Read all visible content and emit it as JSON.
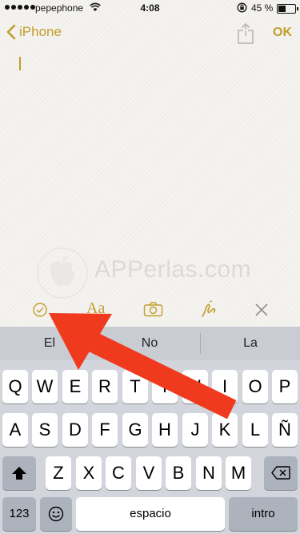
{
  "status_bar": {
    "carrier": "pepephone",
    "time": "4:08",
    "battery_percent": "45 %",
    "battery_level": 0.45
  },
  "nav": {
    "back_label": "iPhone",
    "ok_label": "OK",
    "accent_color": "#c59d2b"
  },
  "watermark": {
    "text": "APPerlas.com"
  },
  "toolbar": {
    "format_label": "Aa",
    "icons": [
      "checklist-icon",
      "format-icon",
      "camera-icon",
      "sketch-icon",
      "close-icon"
    ]
  },
  "keyboard": {
    "predictions": [
      "El",
      "No",
      "La"
    ],
    "row1": [
      "Q",
      "W",
      "E",
      "R",
      "T",
      "Y",
      "U",
      "I",
      "O",
      "P"
    ],
    "row2": [
      "A",
      "S",
      "D",
      "F",
      "G",
      "H",
      "J",
      "K",
      "L",
      "Ñ"
    ],
    "row3": [
      "Z",
      "X",
      "C",
      "V",
      "B",
      "N",
      "M"
    ],
    "numbers_label": "123",
    "space_label": "espacio",
    "return_label": "intro"
  }
}
